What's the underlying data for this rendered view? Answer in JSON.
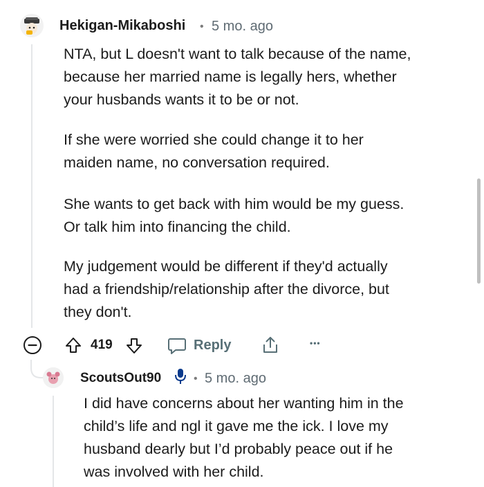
{
  "comment1": {
    "username": "Hekigan-Mikaboshi",
    "separator": "•",
    "age": "5 mo. ago",
    "paragraphs": [
      "NTA, but L doesn't want to talk because of the name,\nbecause her married name is legally hers, whether\nyour husbands wants it to be or not.",
      "If she were worried she could change it to her\nmaiden name, no conversation required.",
      "She wants to get back with him would be my guess.\nOr talk him into financing the child.",
      "My judgement would be different if they'd actually\nhad a friendship/relationship after the divorce, but\nthey don't."
    ],
    "vote_count": "419",
    "reply_label": "Reply",
    "more_label": "•••"
  },
  "comment2": {
    "username": "ScoutsOut90",
    "separator": "•",
    "age": "5 mo. ago",
    "text": "I did have concerns about her wanting him in the\nchild’s life and ngl it gave me the ick. I love my\nhusband dearly but I’d probably peace out if he\nwas involved with her child."
  },
  "icons": {
    "collapse": "minus-circle-icon",
    "upvote": "arrow-up-icon",
    "downvote": "arrow-down-icon",
    "reply": "speech-bubble-icon",
    "share": "share-icon",
    "more": "ellipsis-icon",
    "op_badge": "microphone-icon"
  },
  "colors": {
    "text": "#1c1c1c",
    "muted": "#576f76",
    "thread_line": "#e4e6e8",
    "op_badge": "#0a3a8c"
  }
}
